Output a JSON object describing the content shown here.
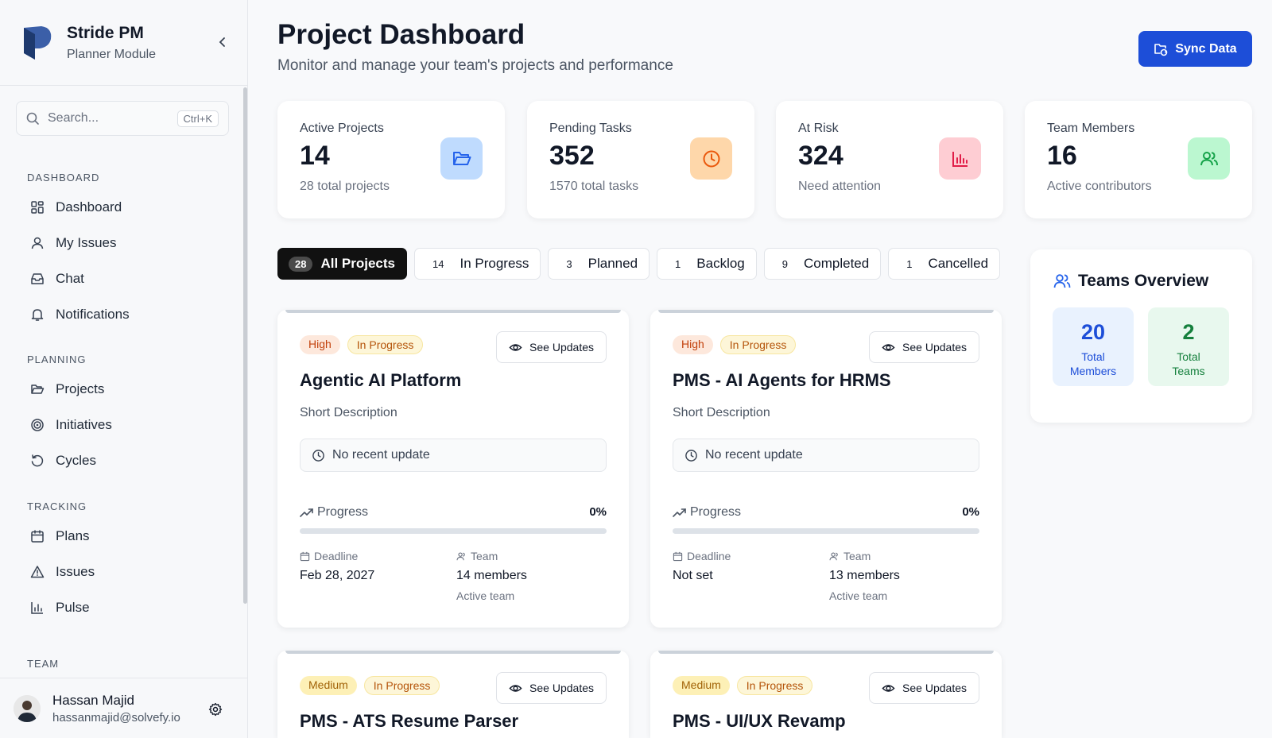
{
  "brand": {
    "title": "Stride PM",
    "subtitle": "Planner Module"
  },
  "search": {
    "placeholder": "Search...",
    "shortcut": "Ctrl+K"
  },
  "nav": {
    "dashboard_head": "DASHBOARD",
    "dashboard_items": [
      "Dashboard",
      "My Issues",
      "Chat",
      "Notifications"
    ],
    "planning_head": "PLANNING",
    "planning_items": [
      "Projects",
      "Initiatives",
      "Cycles"
    ],
    "tracking_head": "TRACKING",
    "tracking_items": [
      "Plans",
      "Issues",
      "Pulse"
    ],
    "team_head": "TEAM"
  },
  "user": {
    "name": "Hassan Majid",
    "email": "hassanmajid@solvefy.io"
  },
  "header": {
    "title": "Project Dashboard",
    "subtitle": "Monitor and manage your team's projects and performance",
    "sync_label": "Sync Data"
  },
  "stats": [
    {
      "label": "Active Projects",
      "value": "14",
      "foot": "28 total projects",
      "icon": "folder-icon",
      "icon_bg": "#bfdbfe",
      "icon_color": "#2563eb"
    },
    {
      "label": "Pending Tasks",
      "value": "352",
      "foot": "1570 total tasks",
      "icon": "clock-icon",
      "icon_bg": "#fed7aa",
      "icon_color": "#ea580c"
    },
    {
      "label": "At Risk",
      "value": "324",
      "foot": "Need attention",
      "icon": "bar-chart-icon",
      "icon_bg": "#fecdd3",
      "icon_color": "#e11d48"
    },
    {
      "label": "Team Members",
      "value": "16",
      "foot": "Active contributors",
      "icon": "users-icon",
      "icon_bg": "#bbf7d0",
      "icon_color": "#16a34a"
    }
  ],
  "filters": [
    {
      "count": "28",
      "label": "All Projects"
    },
    {
      "count": "14",
      "label": "In Progress"
    },
    {
      "count": "3",
      "label": "Planned"
    },
    {
      "count": "1",
      "label": "Backlog"
    },
    {
      "count": "9",
      "label": "Completed"
    },
    {
      "count": "1",
      "label": "Cancelled"
    }
  ],
  "cards": [
    {
      "priority": "High",
      "status": "In Progress",
      "see_label": "See Updates",
      "title": "Agentic AI Platform",
      "desc": "Short Description",
      "update": "No recent update",
      "progress_label": "Progress",
      "progress_pct": "0%",
      "progress_value": 0,
      "deadline_label": "Deadline",
      "deadline": "Feb 28, 2027",
      "team_label": "Team",
      "team": "14 members",
      "team_sub": "Active team"
    },
    {
      "priority": "High",
      "status": "In Progress",
      "see_label": "See Updates",
      "title": "PMS - AI Agents for HRMS",
      "desc": "Short Description",
      "update": "No recent update",
      "progress_label": "Progress",
      "progress_pct": "0%",
      "progress_value": 0,
      "deadline_label": "Deadline",
      "deadline": "Not set",
      "team_label": "Team",
      "team": "13 members",
      "team_sub": "Active team"
    },
    {
      "priority": "Medium",
      "status": "In Progress",
      "see_label": "See Updates",
      "title": "PMS - ATS Resume Parser"
    },
    {
      "priority": "Medium",
      "status": "In Progress",
      "see_label": "See Updates",
      "title": "PMS - UI/UX Revamp"
    }
  ],
  "teams": {
    "title": "Teams Overview",
    "members_value": "20",
    "members_label": "Total Members",
    "teams_value": "2",
    "teams_label": "Total Teams"
  }
}
